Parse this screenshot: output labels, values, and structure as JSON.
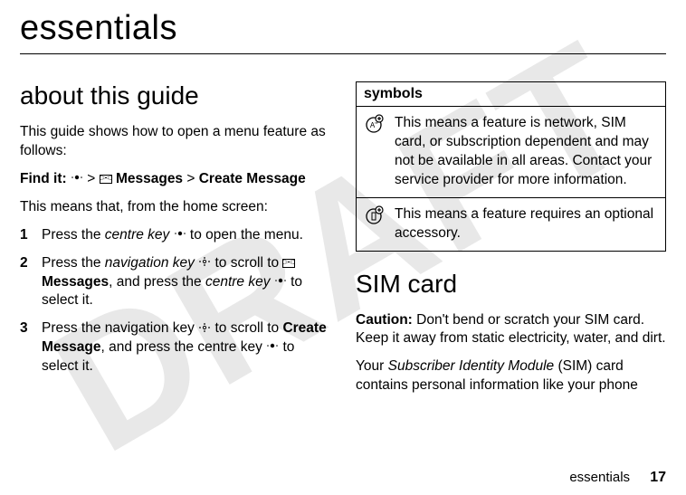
{
  "watermark": "DRAFT",
  "page_title": "essentials",
  "left": {
    "heading": "about this guide",
    "intro": "This guide shows how to open a menu feature as follows:",
    "findit_label": "Find it:",
    "findit_sep1": " > ",
    "findit_messages": "Messages",
    "findit_sep2": " > ",
    "findit_create": "Create Message",
    "means": "This means that, from the home screen:",
    "steps": [
      {
        "num": "1",
        "pre": "Press the ",
        "it1": "centre key",
        "post": " to open the menu."
      },
      {
        "num": "2",
        "pre": "Press the ",
        "it1": "navigation key",
        "mid1": " to scroll to ",
        "bold1": "Messages",
        "mid2": ", and press the ",
        "it2": "centre key",
        "post": " to select it."
      },
      {
        "num": "3",
        "pre": "Press the navigation key ",
        "mid1": " to scroll to ",
        "bold1": "Create Message",
        "mid2": ", and press the centre key ",
        "post": " to select it."
      }
    ]
  },
  "right": {
    "symbols_header": "symbols",
    "rows": [
      {
        "icon": "network-dependent-icon",
        "glyph": "A\"",
        "text": "This means a feature is network, SIM card, or subscription dependent and may not be available in all areas. Contact your service provider for more information."
      },
      {
        "icon": "accessory-required-icon",
        "glyph": "▯",
        "text": "This means a feature requires an optional accessory."
      }
    ],
    "sim_heading": "SIM card",
    "caution_label": "Caution:",
    "caution_text": " Don't bend or scratch your SIM card. Keep it away from static electricity, water, and dirt.",
    "sim_para_pre": "Your ",
    "sim_para_it": "Subscriber Identity Module",
    "sim_para_post": " (SIM) card contains personal information like your phone"
  },
  "footer": {
    "section": "essentials",
    "page": "17"
  }
}
